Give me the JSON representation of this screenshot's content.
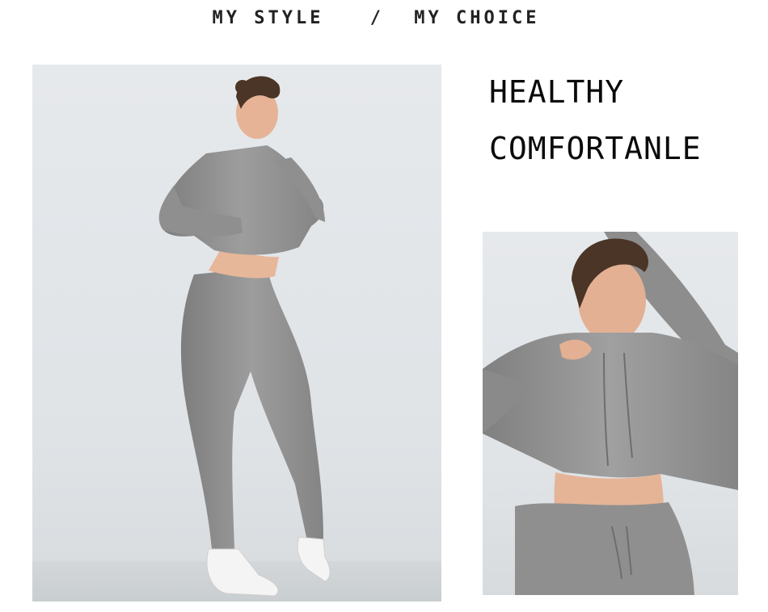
{
  "header": {
    "left": "MY STYLE",
    "separator": "/",
    "right": "MY CHOICE"
  },
  "headlines": {
    "line1": "HEALTHY",
    "line2": "COMFORTANLE"
  },
  "photos": {
    "main": {
      "icon": "full-body-activewear-photo"
    },
    "detail": {
      "icon": "crop-top-closeup-photo"
    }
  },
  "colors": {
    "background": "#ffffff",
    "photo_backdrop": "#e3e6e9",
    "garment_gray": "#8e8e8e",
    "text": "#111111"
  }
}
